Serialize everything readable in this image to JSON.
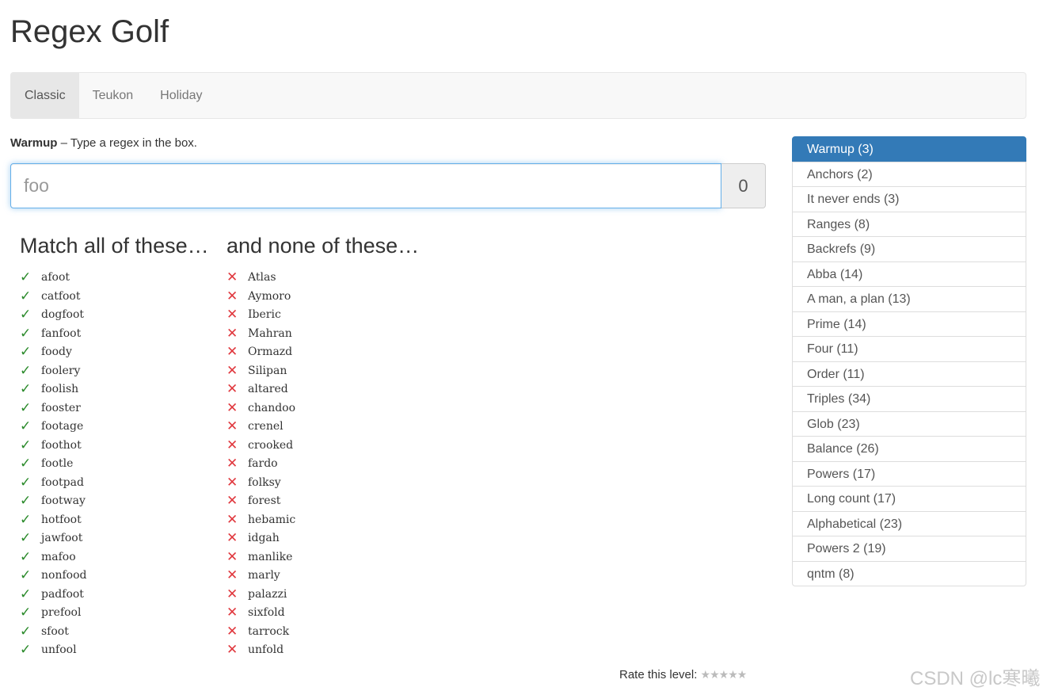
{
  "app": {
    "title": "Regex Golf"
  },
  "tabs": [
    {
      "label": "Classic",
      "active": true
    },
    {
      "label": "Teukon",
      "active": false
    },
    {
      "label": "Holiday",
      "active": false
    }
  ],
  "level": {
    "name": "Warmup",
    "description": " – Type a regex in the box."
  },
  "input": {
    "value": "",
    "placeholder": "foo"
  },
  "score": "0",
  "match": {
    "heading": "Match all of these…",
    "words": [
      "afoot",
      "catfoot",
      "dogfoot",
      "fanfoot",
      "foody",
      "foolery",
      "foolish",
      "fooster",
      "footage",
      "foothot",
      "footle",
      "footpad",
      "footway",
      "hotfoot",
      "jawfoot",
      "mafoo",
      "nonfood",
      "padfoot",
      "prefool",
      "sfoot",
      "unfool"
    ]
  },
  "reject": {
    "heading": "and none of these…",
    "words": [
      "Atlas",
      "Aymoro",
      "Iberic",
      "Mahran",
      "Ormazd",
      "Silipan",
      "altared",
      "chandoo",
      "crenel",
      "crooked",
      "fardo",
      "folksy",
      "forest",
      "hebamic",
      "idgah",
      "manlike",
      "marly",
      "palazzi",
      "sixfold",
      "tarrock",
      "unfold"
    ]
  },
  "rating": {
    "label": "Rate this level: ",
    "stars": "★★★★★"
  },
  "levels": [
    "Warmup (3)",
    "Anchors (2)",
    "It never ends (3)",
    "Ranges (8)",
    "Backrefs (9)",
    "Abba (14)",
    "A man, a plan (13)",
    "Prime (14)",
    "Four (11)",
    "Order (11)",
    "Triples (34)",
    "Glob (23)",
    "Balance (26)",
    "Powers (17)",
    "Long count (17)",
    "Alphabetical (23)",
    "Powers 2 (19)",
    "qntm (8)"
  ],
  "active_level_index": 0,
  "watermark": "CSDN @lc寒曦",
  "colors": {
    "accent": "#337ab7",
    "match_mark": "#2a8a2a",
    "reject_mark": "#e0383e"
  },
  "icons": {
    "match": "check-icon",
    "reject": "cross-icon"
  }
}
